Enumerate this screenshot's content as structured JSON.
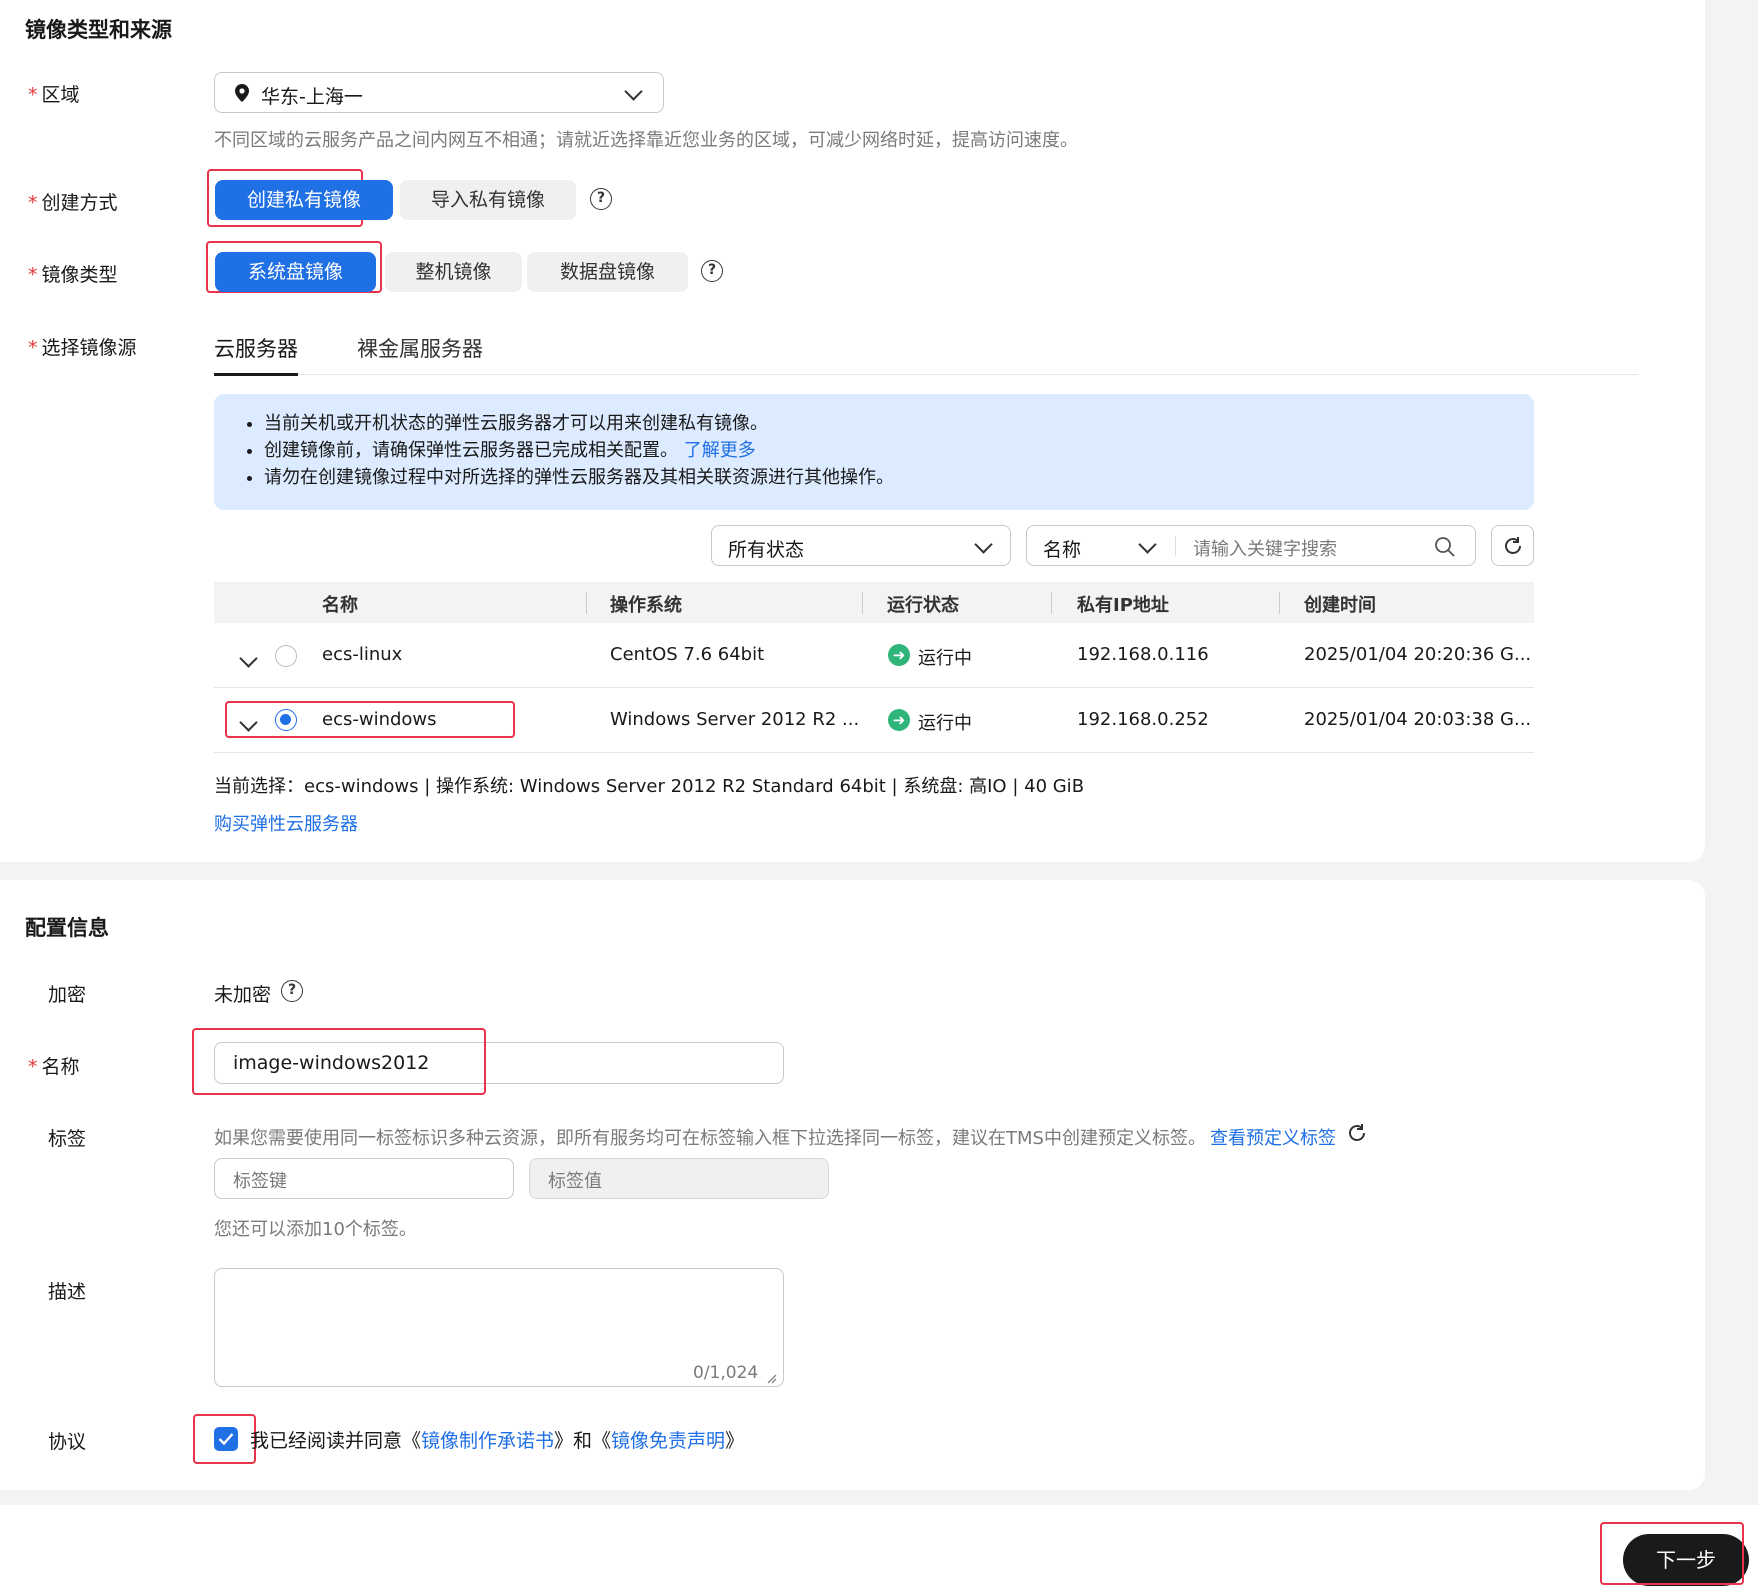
{
  "section1": {
    "title": "镜像类型和来源",
    "region": {
      "label": "区域",
      "value": "华东-上海一",
      "hint": "不同区域的云服务产品之间内网互不相通；请就近选择靠近您业务的区域，可减少网络时延，提高访问速度。"
    },
    "create_method": {
      "label": "创建方式",
      "options": [
        "创建私有镜像",
        "导入私有镜像"
      ]
    },
    "image_type": {
      "label": "镜像类型",
      "options": [
        "系统盘镜像",
        "整机镜像",
        "数据盘镜像"
      ]
    },
    "source": {
      "label": "选择镜像源",
      "tabs": [
        "云服务器",
        "裸金属服务器"
      ],
      "notices": [
        "当前关机或开机状态的弹性云服务器才可以用来创建私有镜像。",
        "创建镜像前，请确保弹性云服务器已完成相关配置。",
        "请勿在创建镜像过程中对所选择的弹性云服务器及其相关联资源进行其他操作。"
      ],
      "learn_more": "了解更多",
      "status_filter": "所有状态",
      "search_field": "名称",
      "search_placeholder": "请输入关键字搜索",
      "columns": [
        "名称",
        "操作系统",
        "运行状态",
        "私有IP地址",
        "创建时间"
      ],
      "rows": [
        {
          "name": "ecs-linux",
          "os": "CentOS 7.6 64bit",
          "status": "运行中",
          "ip": "192.168.0.116",
          "created": "2025/01/04 20:20:36 G...",
          "selected": false
        },
        {
          "name": "ecs-windows",
          "os": "Windows Server 2012 R2 ...",
          "status": "运行中",
          "ip": "192.168.0.252",
          "created": "2025/01/04 20:03:38 G...",
          "selected": true
        }
      ],
      "current_selection": "当前选择：ecs-windows | 操作系统: Windows Server 2012 R2 Standard 64bit | 系统盘: 高IO | 40 GiB",
      "buy_link": "购买弹性云服务器"
    }
  },
  "section2": {
    "title": "配置信息",
    "encryption": {
      "label": "加密",
      "value": "未加密"
    },
    "name": {
      "label": "名称",
      "value": "image-windows2012"
    },
    "tags": {
      "label": "标签",
      "hint": "如果您需要使用同一标签标识多种云资源，即所有服务均可在标签输入框下拉选择同一标签，建议在TMS中创建预定义标签。",
      "link": "查看预定义标签",
      "key_placeholder": "标签键",
      "value_placeholder": "标签值",
      "remaining": "您还可以添加10个标签。"
    },
    "description": {
      "label": "描述",
      "counter": "0/1,024"
    },
    "agreement": {
      "label": "协议",
      "prefix": "我已经阅读并同意《",
      "doc1": "镜像制作承诺书",
      "middle": "》和《",
      "doc2": "镜像免责声明",
      "suffix": "》"
    }
  },
  "footer": {
    "next": "下一步"
  },
  "colors": {
    "accent": "#1f6fe5",
    "highlight": "#e8334a",
    "running": "#2fb57a"
  }
}
